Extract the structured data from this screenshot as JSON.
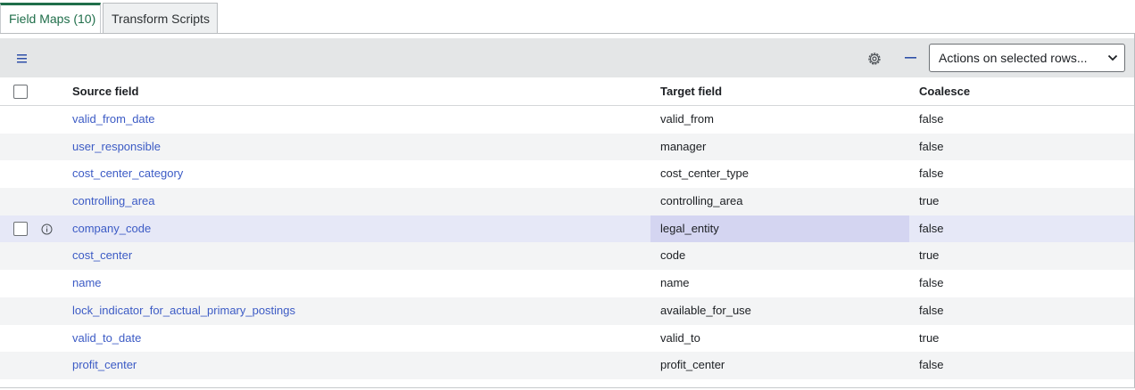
{
  "tabs": [
    {
      "label": "Field Maps (10)"
    },
    {
      "label": "Transform Scripts"
    }
  ],
  "toolbar": {
    "menu_icon": "hamburger-icon",
    "settings_icon": "gear-icon",
    "collapse_icon": "minus-icon",
    "actions_select": {
      "selected": "Actions on selected rows..."
    }
  },
  "table": {
    "columns": [
      "Source field",
      "Target field",
      "Coalesce"
    ],
    "rows": [
      {
        "source": "valid_from_date",
        "target": "valid_from",
        "coalesce": "false"
      },
      {
        "source": "user_responsible",
        "target": "manager",
        "coalesce": "false"
      },
      {
        "source": "cost_center_category",
        "target": "cost_center_type",
        "coalesce": "false"
      },
      {
        "source": "controlling_area",
        "target": "controlling_area",
        "coalesce": "true"
      },
      {
        "source": "company_code",
        "target": "legal_entity",
        "coalesce": "false"
      },
      {
        "source": "cost_center",
        "target": "code",
        "coalesce": "true"
      },
      {
        "source": "name",
        "target": "name",
        "coalesce": "false"
      },
      {
        "source": "lock_indicator_for_actual_primary_postings",
        "target": "available_for_use",
        "coalesce": "false"
      },
      {
        "source": "valid_to_date",
        "target": "valid_to",
        "coalesce": "true"
      },
      {
        "source": "profit_center",
        "target": "profit_center",
        "coalesce": "false"
      }
    ]
  },
  "colors": {
    "accent": "#1f6e4a",
    "link": "#3c5bc5",
    "hover_row": "#e6e8f7"
  }
}
